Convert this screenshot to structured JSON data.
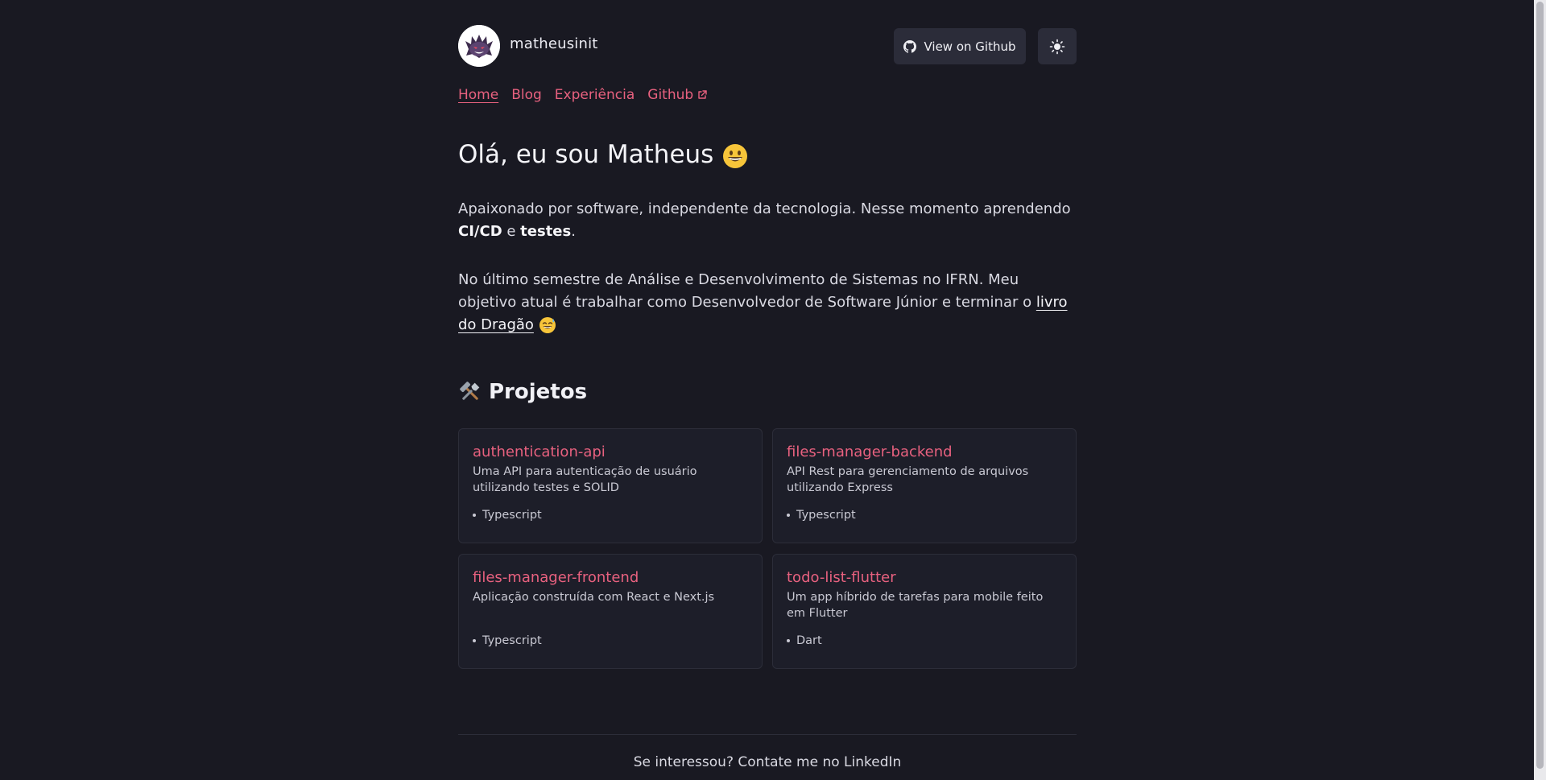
{
  "header": {
    "brand": "matheusinit",
    "github_button_label": "View on Github"
  },
  "nav": {
    "home": "Home",
    "blog": "Blog",
    "experience": "Experiência",
    "github": "Github"
  },
  "hero": {
    "title": "Olá, eu sou Matheus",
    "p1_text_a": "Apaixonado por software, independente da tecnologia. Nesse momento aprendendo ",
    "p1_bold_a": "CI/CD",
    "p1_text_b": " e ",
    "p1_bold_b": "testes",
    "p1_text_c": ".",
    "p2_text": "No último semestre de Análise e Desenvolvimento de Sistemas no IFRN. Meu objetivo atual é trabalhar como Desenvolvedor de Software Júnior e terminar o ",
    "p2_link": "livro do Dragão"
  },
  "projects": {
    "heading": "Projetos",
    "items": [
      {
        "name": "authentication-api",
        "description": "Uma API para autenticação de usuário utilizando testes e SOLID",
        "language": "Typescript"
      },
      {
        "name": "files-manager-backend",
        "description": "API Rest para gerenciamento de arquivos utilizando Express",
        "language": "Typescript"
      },
      {
        "name": "files-manager-frontend",
        "description": "Aplicação construída com React e Next.js",
        "language": "Typescript"
      },
      {
        "name": "todo-list-flutter",
        "description": "Um app híbrido de tarefas para mobile feito em Flutter",
        "language": "Dart"
      }
    ]
  },
  "footer": {
    "text": "Se interessou? Contate me no LinkedIn"
  },
  "colors": {
    "background": "#191922",
    "accent": "#e8617f",
    "card": "#1d1e29",
    "button": "#2b2c39"
  },
  "icons": [
    "gengar-avatar",
    "github-icon",
    "sun-icon",
    "external-link-icon",
    "grinning-face-emoji",
    "sweat-smile-emoji",
    "tools-emoji"
  ]
}
